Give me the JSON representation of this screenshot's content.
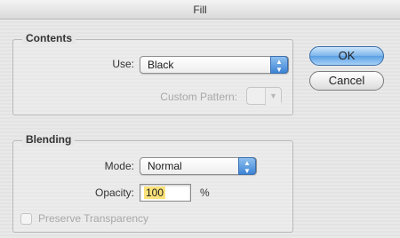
{
  "window": {
    "title": "Fill"
  },
  "contents": {
    "legend": "Contents",
    "use_label": "Use:",
    "use_value": "Black",
    "custom_pattern_label": "Custom Pattern:"
  },
  "blending": {
    "legend": "Blending",
    "mode_label": "Mode:",
    "mode_value": "Normal",
    "opacity_label": "Opacity:",
    "opacity_value": "100",
    "opacity_unit": "%",
    "preserve_label": "Preserve Transparency"
  },
  "buttons": {
    "ok": "OK",
    "cancel": "Cancel"
  },
  "colors": {
    "default_button": "#7bb5ec",
    "popup_arrow": "#3d84d6",
    "opacity_highlight": "#fbe27a"
  },
  "icons": {
    "popup_arrows": "updown-arrows-icon",
    "pattern_arrow": "triangle-down-icon"
  }
}
